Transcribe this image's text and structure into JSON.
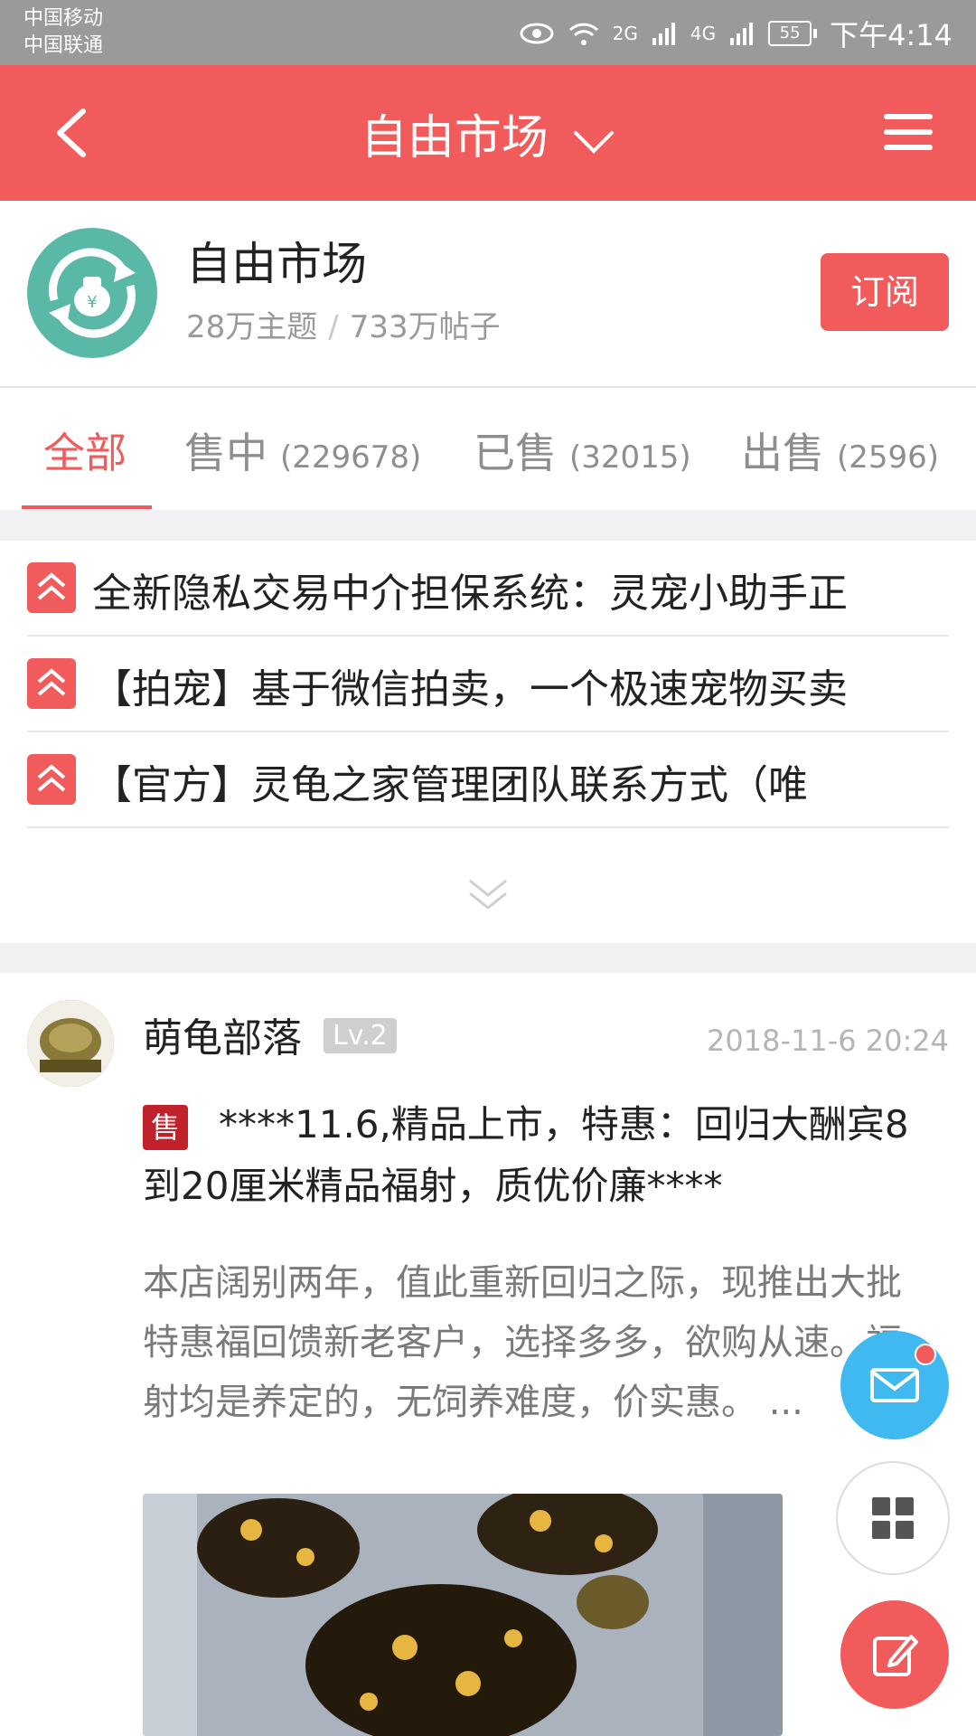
{
  "status_bar": {
    "carrier1": "中国移动",
    "carrier2": "中国联通",
    "signal1": "2G",
    "signal2": "4G",
    "battery": "55",
    "time": "下午4:14"
  },
  "app_bar": {
    "title": "自由市场",
    "background_color": "#f25b5b"
  },
  "forum": {
    "name": "自由市场",
    "topics": "28万主题",
    "separator": "/",
    "posts": "733万帖子",
    "subscribe_label": "订阅"
  },
  "tabs": [
    {
      "label": "全部",
      "count": ""
    },
    {
      "label": "售中",
      "count": "(229678)"
    },
    {
      "label": "已售",
      "count": "(32015)"
    },
    {
      "label": "出售",
      "count": "(2596)"
    }
  ],
  "pinned": [
    {
      "text": "全新隐私交易中介担保系统：灵宠小助手正"
    },
    {
      "text": "【拍宠】基于微信拍卖，一个极速宠物买卖"
    },
    {
      "text": "【官方】灵龟之家管理团队联系方式（唯"
    }
  ],
  "post": {
    "author": "萌龟部落",
    "level": "Lv.2",
    "time": "2018-11-6 20:24",
    "badge": "售",
    "title": "****11.6,精品上市，特惠：回归大酬宾8到20厘米精品福射，质优价廉****",
    "body": "本店阔别两年，值此重新回归之际，现推出大批特惠福回馈新老客户，选择多多，欲购从速。福射均是养定的，无饲养难度，价实惠。 ..."
  }
}
